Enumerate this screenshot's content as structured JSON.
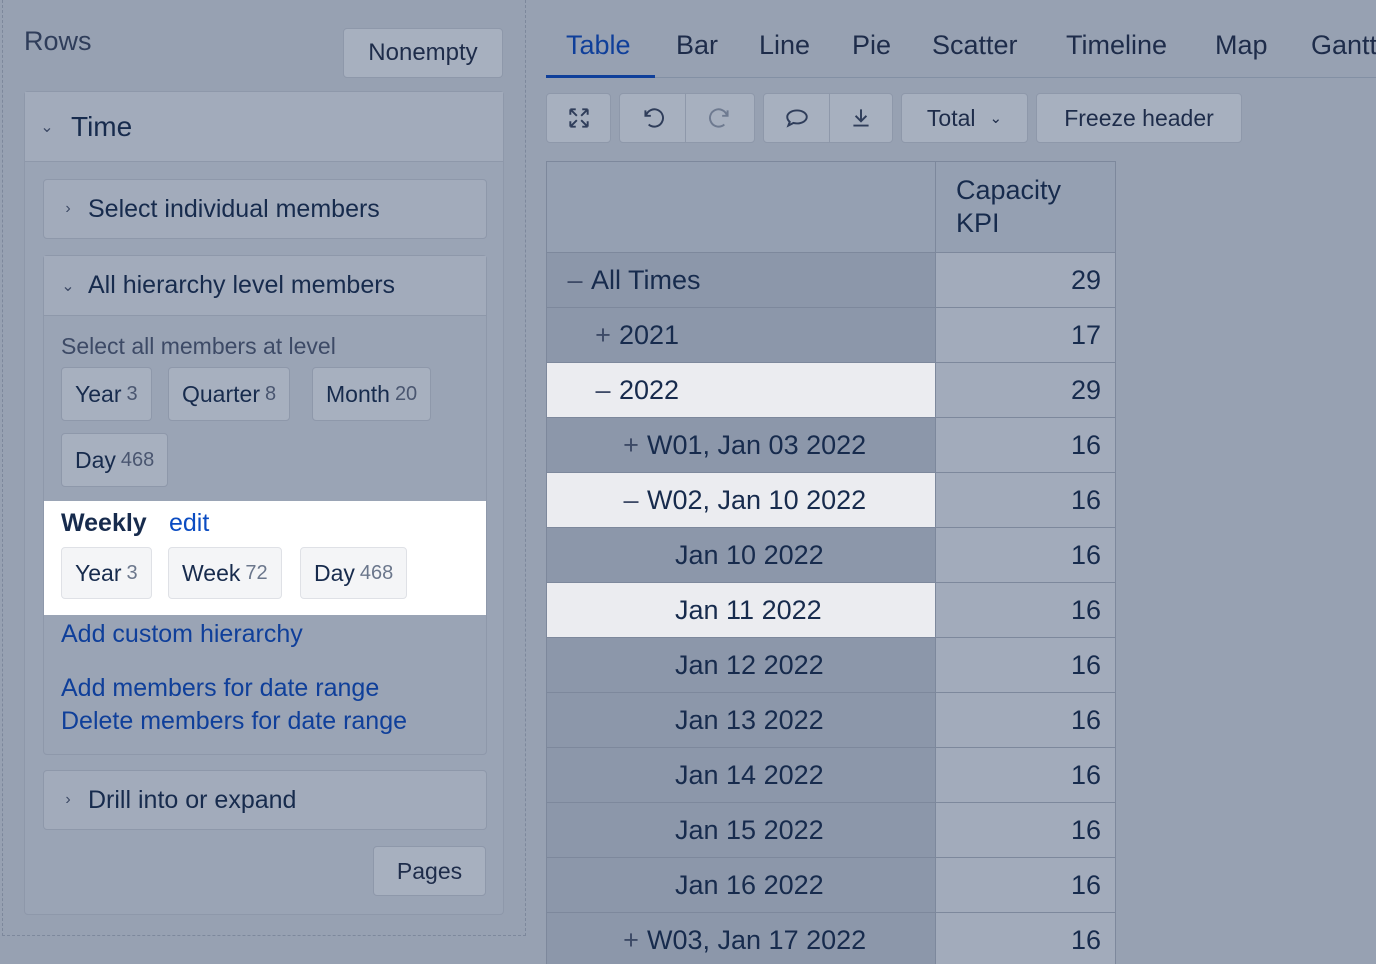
{
  "left": {
    "rows_title": "Rows",
    "nonempty_label": "Nonempty",
    "time_label": "Time",
    "select_individual_label": "Select individual members",
    "all_hierarchy_label": "All hierarchy level members",
    "select_all_level_label": "Select all members at level",
    "levels": [
      {
        "name": "Year",
        "count": "3"
      },
      {
        "name": "Quarter",
        "count": "8"
      },
      {
        "name": "Month",
        "count": "20"
      },
      {
        "name": "Day",
        "count": "468"
      }
    ],
    "weekly": {
      "title": "Weekly",
      "edit_label": "edit",
      "levels": [
        {
          "name": "Year",
          "count": "3"
        },
        {
          "name": "Week",
          "count": "72"
        },
        {
          "name": "Day",
          "count": "468"
        }
      ]
    },
    "add_custom_hierarchy": "Add custom hierarchy",
    "add_date_range": "Add members for date range",
    "delete_date_range": "Delete members for date range",
    "drill_label": "Drill into or expand",
    "pages_label": "Pages"
  },
  "tabs": [
    "Table",
    "Bar",
    "Line",
    "Pie",
    "Scatter",
    "Timeline",
    "Map",
    "Gantt"
  ],
  "toolbar": {
    "icons": [
      "fullscreen-icon",
      "undo-icon",
      "redo-icon",
      "comment-icon",
      "download-icon"
    ],
    "total_label": "Total",
    "freeze_label": "Freeze header"
  },
  "table": {
    "column_header_line1": "Capacity",
    "column_header_line2": "KPI",
    "rows": [
      {
        "toggle": "–",
        "label": "All Times",
        "value": "29"
      },
      {
        "toggle": "+",
        "label": "2021",
        "value": "17"
      },
      {
        "toggle": "–",
        "label": "2022",
        "value": "29"
      },
      {
        "toggle": "+",
        "label": "W01, Jan 03 2022",
        "value": "16"
      },
      {
        "toggle": "–",
        "label": "W02, Jan 10 2022",
        "value": "16"
      },
      {
        "toggle": "",
        "label": "Jan 10 2022",
        "value": "16"
      },
      {
        "toggle": "",
        "label": "Jan 11 2022",
        "value": "16"
      },
      {
        "toggle": "",
        "label": "Jan 12 2022",
        "value": "16"
      },
      {
        "toggle": "",
        "label": "Jan 13 2022",
        "value": "16"
      },
      {
        "toggle": "",
        "label": "Jan 14 2022",
        "value": "16"
      },
      {
        "toggle": "",
        "label": "Jan 15 2022",
        "value": "16"
      },
      {
        "toggle": "",
        "label": "Jan 16 2022",
        "value": "16"
      },
      {
        "toggle": "+",
        "label": "W03, Jan 17 2022",
        "value": "16"
      }
    ]
  }
}
